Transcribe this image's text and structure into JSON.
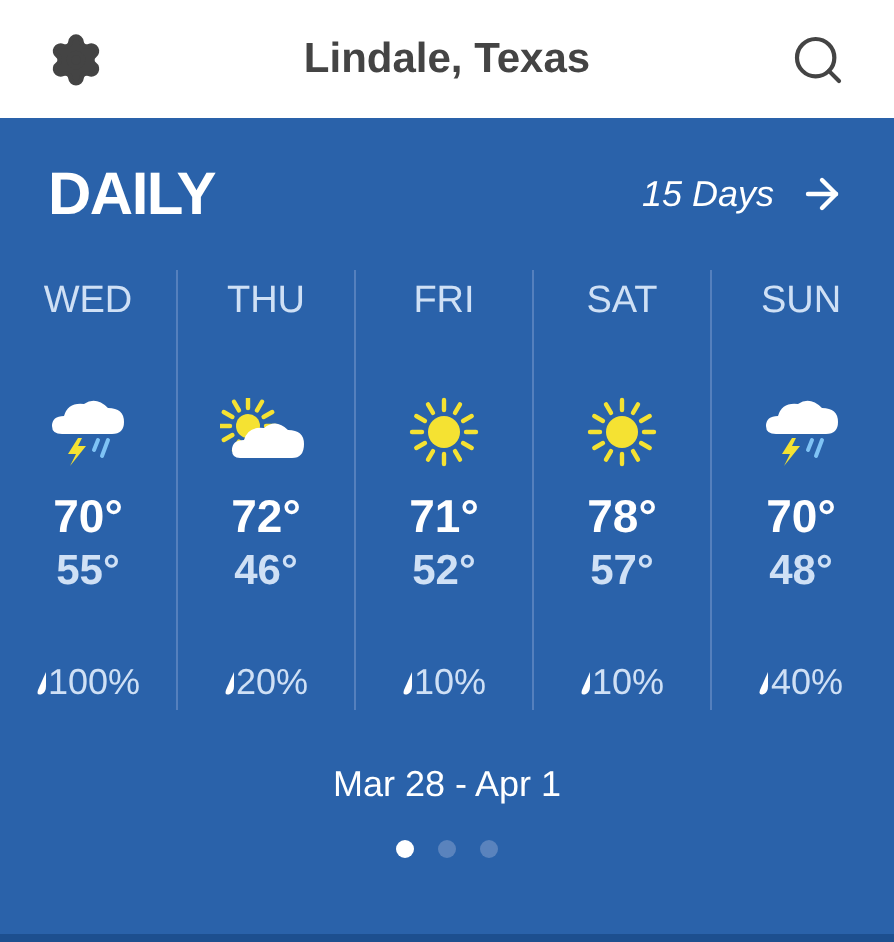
{
  "header": {
    "location": "Lindale, Texas"
  },
  "section": {
    "title": "DAILY",
    "link": "15 Days"
  },
  "days": [
    {
      "day": "WED",
      "kind": "storm",
      "high": "70°",
      "low": "55°",
      "precip": "100%"
    },
    {
      "day": "THU",
      "kind": "partly_cloudy",
      "high": "72°",
      "low": "46°",
      "precip": "20%"
    },
    {
      "day": "FRI",
      "kind": "sunny",
      "high": "71°",
      "low": "52°",
      "precip": "10%"
    },
    {
      "day": "SAT",
      "kind": "sunny",
      "high": "78°",
      "low": "57°",
      "precip": "10%"
    },
    {
      "day": "SUN",
      "kind": "storm",
      "high": "70°",
      "low": "48°",
      "precip": "40%"
    }
  ],
  "range": "Mar 28 - Apr 1",
  "pages": [
    {
      "selected": true
    },
    {
      "selected": false
    },
    {
      "selected": false
    }
  ]
}
